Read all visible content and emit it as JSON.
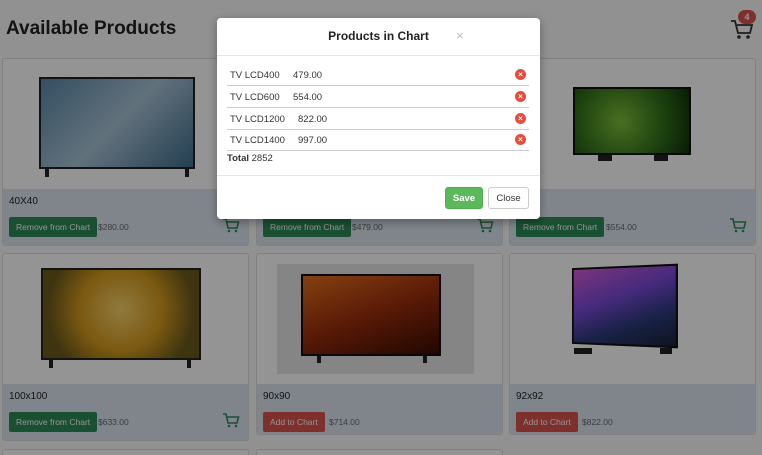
{
  "page": {
    "title": "Available Products",
    "cart_count": "4"
  },
  "products": [
    {
      "name": "40X40",
      "action": "Remove from Chart",
      "price": "$280.00"
    },
    {
      "name": "",
      "action": "Remove from Chart",
      "price": "$479.00"
    },
    {
      "name": "",
      "action": "Remove from Chart",
      "price": "$554.00"
    },
    {
      "name": "100x100",
      "action": "Remove from Chart",
      "price": "$633.00"
    },
    {
      "name": "90x90",
      "action": "Add to Chart",
      "price": "$714.00"
    },
    {
      "name": "92x92",
      "action": "Add to Chart",
      "price": "$822.00"
    }
  ],
  "modal": {
    "title": "Products in Chart",
    "close_symbol": "×",
    "items": [
      {
        "name": "TV LCD400",
        "price": "479.00"
      },
      {
        "name": "TV LCD600",
        "price": "554.00"
      },
      {
        "name": "TV LCD1200",
        "price": "822.00"
      },
      {
        "name": "TV LCD1400",
        "price": "997.00"
      }
    ],
    "total_label": "Total",
    "total_value": "2852",
    "save_label": "Save",
    "close_label": "Close"
  },
  "colors": {
    "remove_button": "#2e8b57",
    "add_button": "#d9534f",
    "save_button": "#5cb85c",
    "badge": "#d9534f"
  },
  "icons": {
    "cart": "shopping-cart-icon",
    "remove_item": "remove-circle-icon"
  }
}
